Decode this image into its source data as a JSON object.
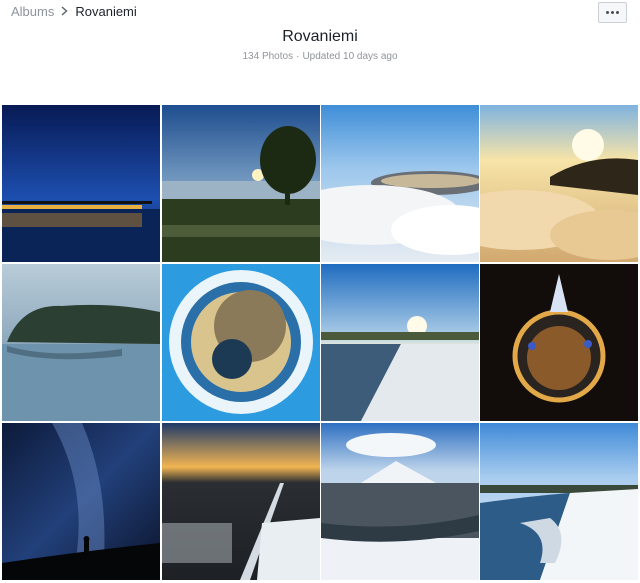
{
  "breadcrumb": {
    "albums_label": "Albums",
    "current_label": "Rovaniemi"
  },
  "header": {
    "title": "Rovaniemi",
    "photo_count": "134 Photos",
    "updated": "Updated 10 days ago"
  },
  "actions": {
    "more_icon": "ellipsis-icon"
  },
  "photos": [
    {
      "subject": "night-bridge-lights"
    },
    {
      "subject": "sunset-tree-lake"
    },
    {
      "subject": "aerial-town-fog"
    },
    {
      "subject": "sunrise-above-clouds"
    },
    {
      "subject": "foggy-forest-lake"
    },
    {
      "subject": "tiny-planet-day"
    },
    {
      "subject": "winter-sunset-river"
    },
    {
      "subject": "tiny-planet-night"
    },
    {
      "subject": "milky-way-silhouette"
    },
    {
      "subject": "aerial-sunset-road"
    },
    {
      "subject": "ski-resort-aerial"
    },
    {
      "subject": "frozen-river-aerial"
    }
  ]
}
